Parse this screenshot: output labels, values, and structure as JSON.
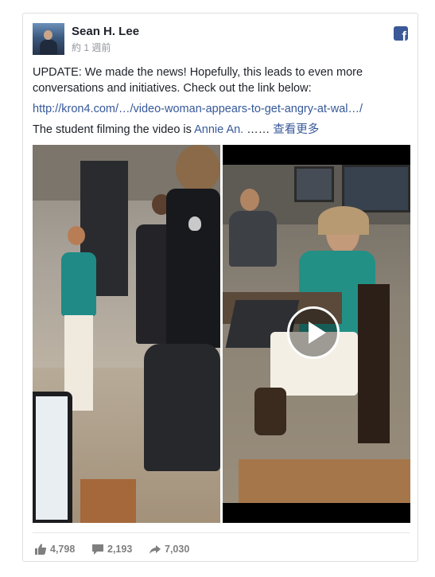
{
  "post": {
    "author": "Sean H. Lee",
    "time": "約 1 週前",
    "text_line1": "UPDATE: We made the news! Hopefully, this leads to even more conversations and initiatives. Check out the link below:",
    "link": "http://kron4.com/…/video-woman-appears-to-get-angry-at-wal…/",
    "text_line2_prefix": "The student filming the video is ",
    "mention": "Annie An.",
    "ellipsis": " …… ",
    "see_more": "查看更多"
  },
  "stats": {
    "likes": "4,798",
    "comments": "2,193",
    "shares": "7,030"
  },
  "icons": {
    "brand": "facebook-icon",
    "like": "thumbs-up-icon",
    "comment": "comment-bubble-icon",
    "share": "share-arrow-icon",
    "play": "play-icon"
  },
  "colors": {
    "facebook_blue": "#3b5998",
    "link_blue": "#365899",
    "meta_gray": "#90949c"
  }
}
